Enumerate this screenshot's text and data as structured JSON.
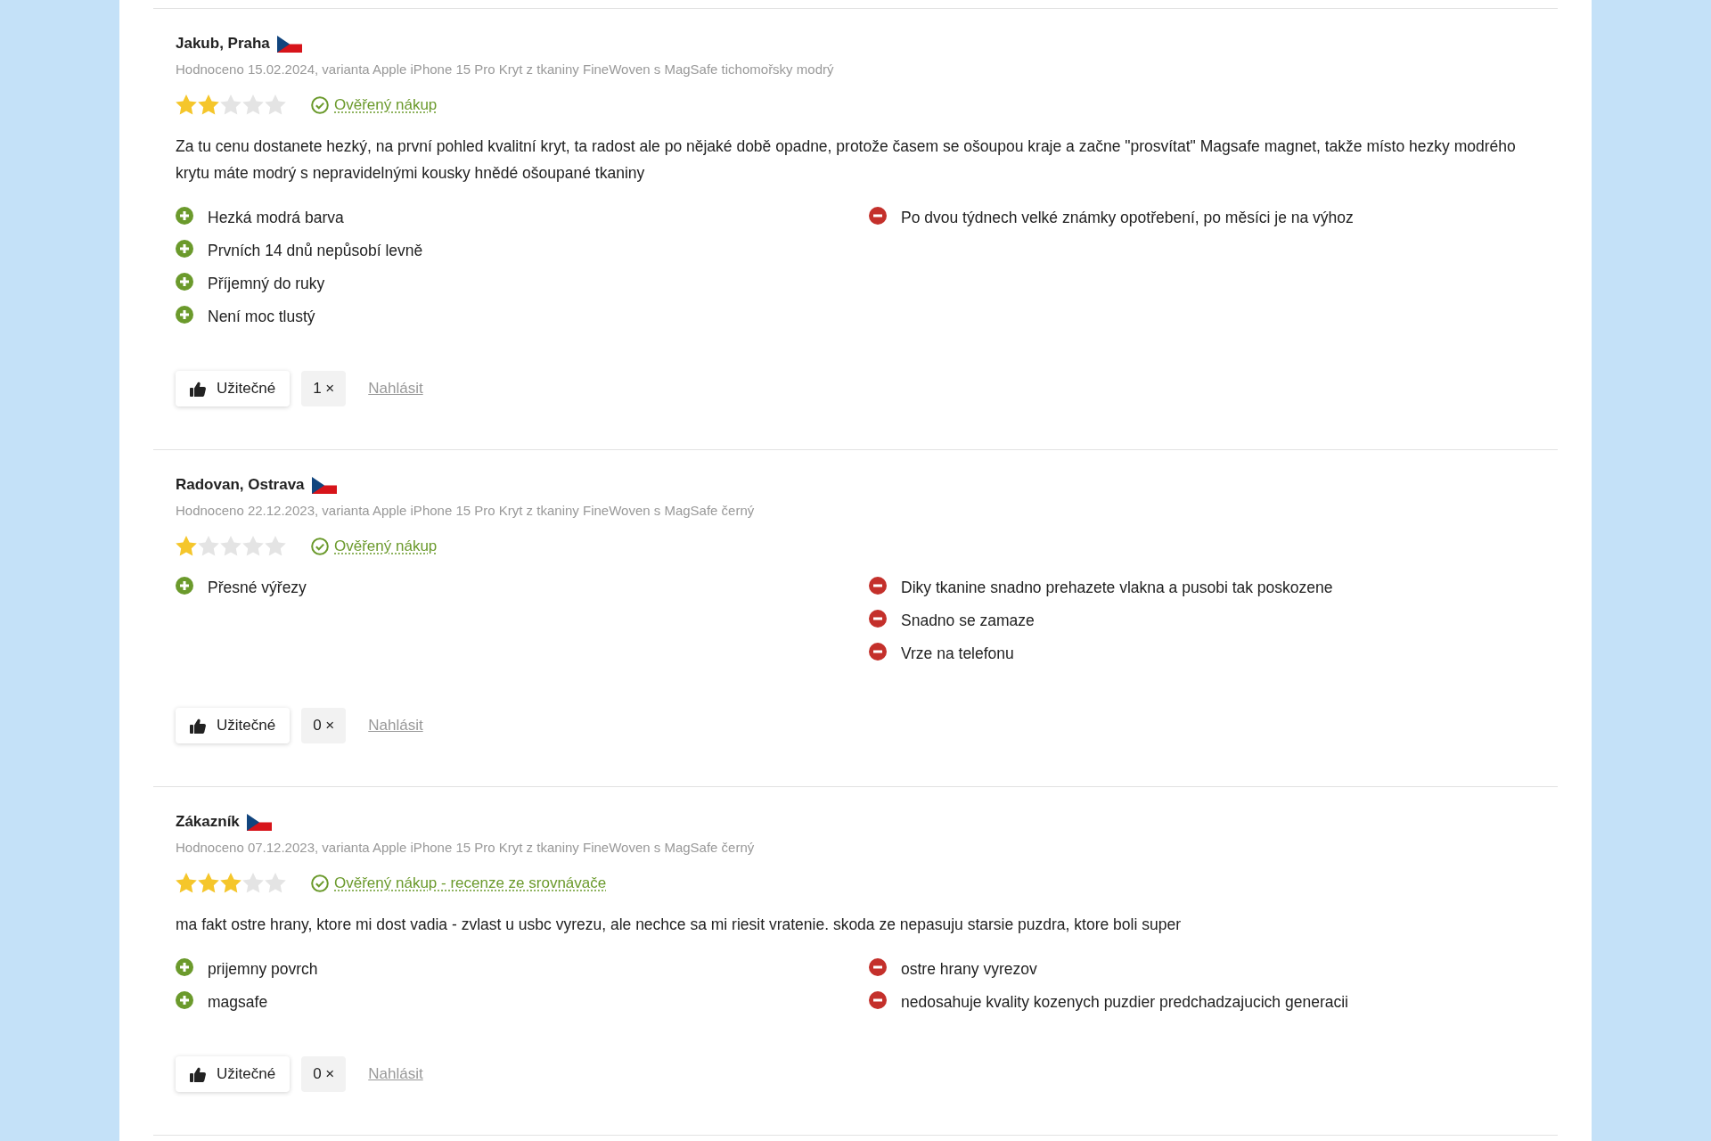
{
  "reviews": [
    {
      "author": "Jakub, Praha",
      "meta": "Hodnoceno 15.02.2024, varianta Apple iPhone 15 Pro Kryt z tkaniny FineWoven s MagSafe tichomořsky modrý",
      "stars": 2,
      "verified": "Ověřený nákup",
      "text": "Za tu cenu dostanete hezký, na první pohled kvalitní kryt, ta radost ale po nějaké době opadne, protože časem se ošoupou kraje a začne \"prosvítat\" Magsafe magnet, takže místo hezky modrého krytu máte modrý s nepravidelnými kousky hnědé ošoupané tkaniny",
      "pros": [
        "Hezká modrá barva",
        "Prvních 14 dnů nepůsobí levně",
        "Příjemný do ruky",
        "Není moc tlustý"
      ],
      "cons": [
        "Po dvou týdnech velké známky opotřebení, po měsíci je na výhoz"
      ],
      "helpful": "Užitečné",
      "count": "1 ×",
      "report": "Nahlásit"
    },
    {
      "author": "Radovan, Ostrava",
      "meta": "Hodnoceno 22.12.2023, varianta Apple iPhone 15 Pro Kryt z tkaniny FineWoven s MagSafe černý",
      "stars": 1,
      "verified": "Ověřený nákup",
      "pros": [
        "Přesné výřezy"
      ],
      "cons": [
        "Diky tkanine snadno prehazete vlakna a pusobi tak poskozene",
        "Snadno se zamaze",
        "Vrze na telefonu"
      ],
      "helpful": "Užitečné",
      "count": "0 ×",
      "report": "Nahlásit"
    },
    {
      "author": "Zákazník",
      "meta": "Hodnoceno 07.12.2023, varianta Apple iPhone 15 Pro Kryt z tkaniny FineWoven s MagSafe černý",
      "stars": 3,
      "verified": "Ověřený nákup - recenze ze srovnávače",
      "text": "ma fakt ostre hrany, ktore mi dost vadia - zvlast u usbc vyrezu, ale nechce sa mi riesit vratenie. skoda ze nepasuju starsie puzdra, ktore boli super",
      "pros": [
        "prijemny povrch",
        "magsafe"
      ],
      "cons": [
        "ostre hrany vyrezov",
        "nedosahuje kvality kozenych puzdier predchadzajucich generacii"
      ],
      "helpful": "Užitečné",
      "count": "0 ×",
      "report": "Nahlásit"
    }
  ]
}
